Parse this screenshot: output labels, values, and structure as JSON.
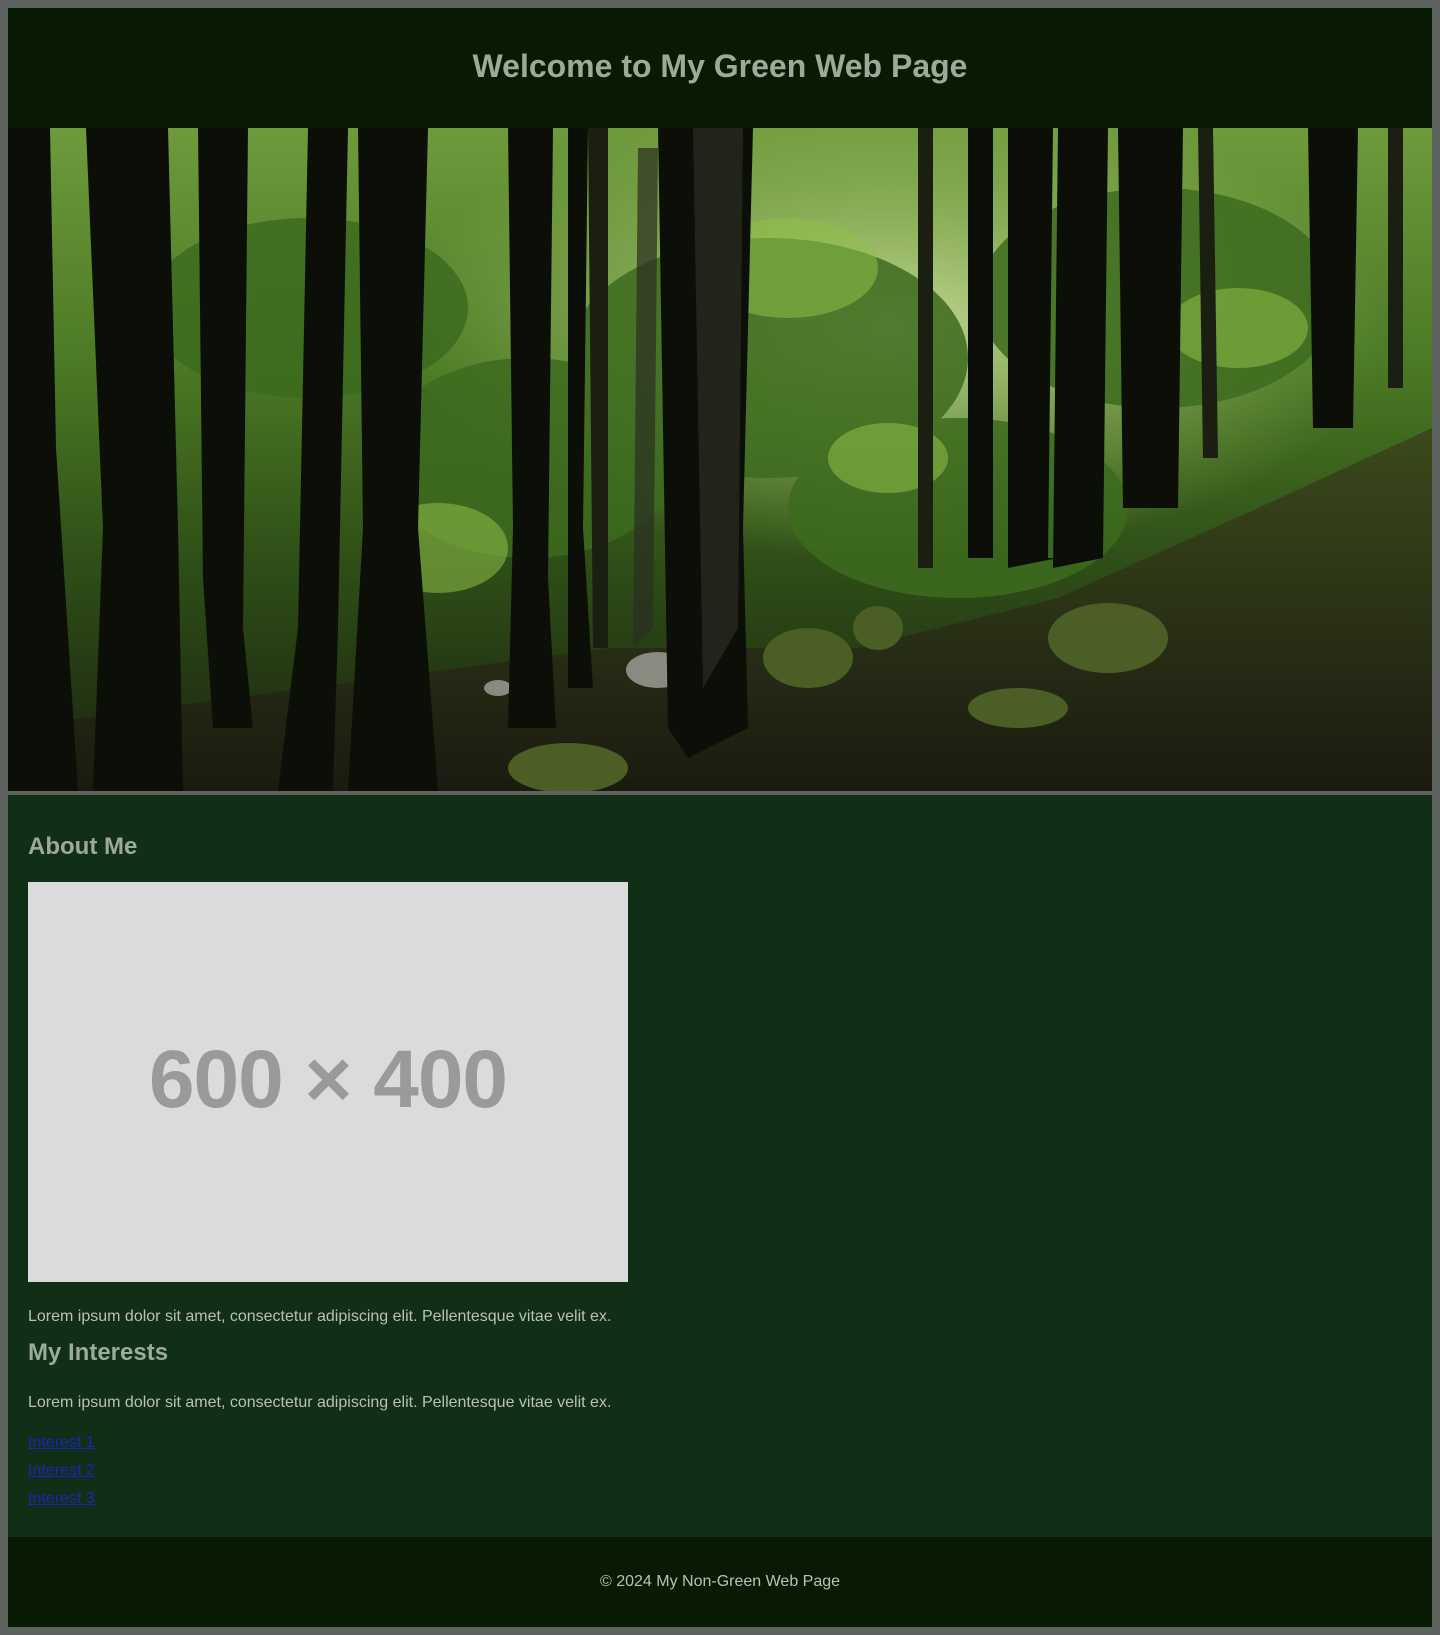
{
  "header": {
    "title": "Welcome to My Green Web Page"
  },
  "hero": {
    "alt": "forest-photo"
  },
  "about": {
    "heading": "About Me",
    "placeholder_text": "600 × 400",
    "text": "Lorem ipsum dolor sit amet, consectetur adipiscing elit. Pellentesque vitae velit ex."
  },
  "interests": {
    "heading": "My Interests",
    "text": "Lorem ipsum dolor sit amet, consectetur adipiscing elit. Pellentesque vitae velit ex.",
    "links": [
      "Interest 1",
      "Interest 2",
      "Interest 3"
    ]
  },
  "footer": {
    "text": "© 2024 My Non-Green Web Page"
  },
  "colors": {
    "header_bg": "#081a04",
    "main_bg": "#112e16",
    "heading_text": "#9aab98",
    "body_text": "#b9c1b6",
    "link": "#1b26b8"
  }
}
